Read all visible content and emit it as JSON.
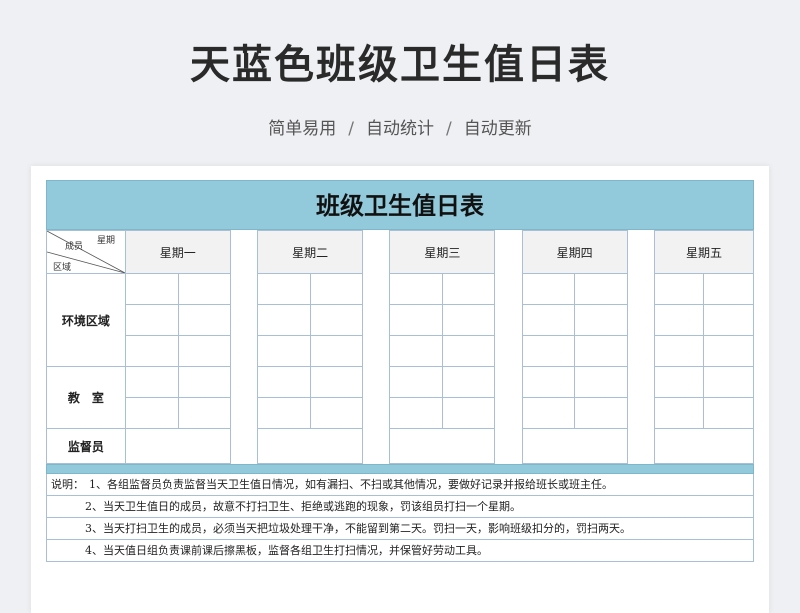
{
  "header": {
    "title": "天蓝色班级卫生值日表",
    "subtitle_parts": [
      "简单易用",
      "自动统计",
      "自动更新"
    ],
    "separator": "/"
  },
  "sheet": {
    "title": "班级卫生值日表",
    "corner": {
      "day_label": "星期",
      "member_label": "成员",
      "area_label": "区域"
    },
    "days": [
      "星期一",
      "星期二",
      "星期三",
      "星期四",
      "星期五"
    ],
    "rows": [
      "环境区域",
      "教　室",
      "监督员"
    ],
    "notes_lead": "说明：",
    "notes": [
      "1、各组监督员负责监督当天卫生值日情况，如有漏扫、不扫或其他情况，要做好记录并报给班长或班主任。",
      "2、当天卫生值日的成员，故意不打扫卫生、拒绝或逃跑的现象，罚该组员打扫一个星期。",
      "3、当天打扫卫生的成员，必须当天把垃圾处理干净，不能留到第二天。罚扫一天，影响班级扣分的，罚扫两天。",
      "4、当天值日组负责课前课后擦黑板，监督各组卫生打扫情况，并保管好劳动工具。"
    ]
  },
  "colors": {
    "header_blue": "#92c9db",
    "grid_line": "#a9bfd6",
    "day_bg": "#f2f2f2"
  }
}
